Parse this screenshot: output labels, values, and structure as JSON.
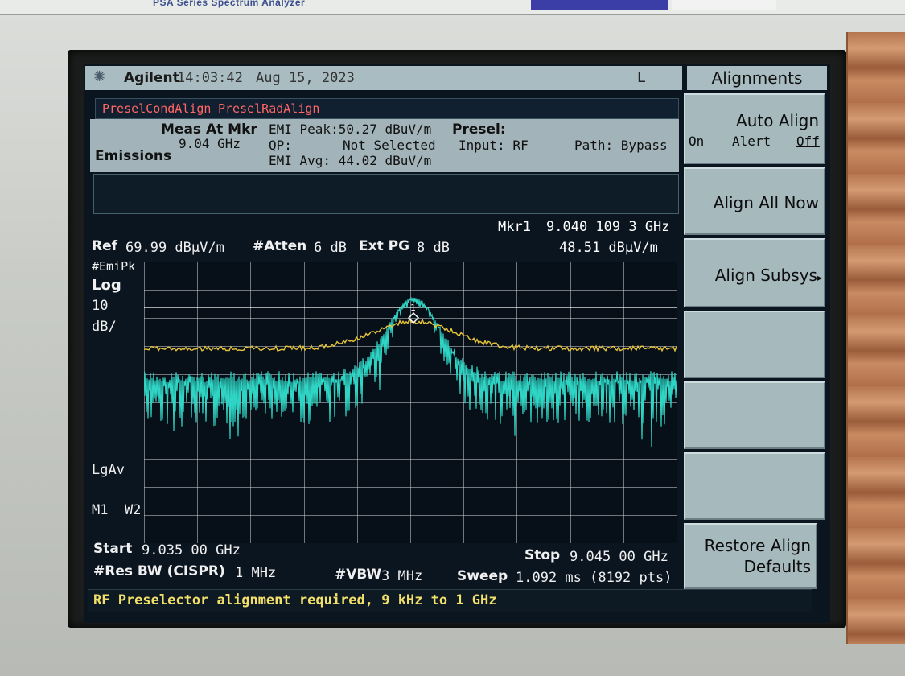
{
  "bezel": {
    "brand_text": "PSA Series Spectrum Analyzer"
  },
  "title_bar": {
    "logo_icon": "agilent-spark-icon",
    "brand": "Agilent",
    "time": "14:03:42",
    "date": "Aug 15, 2023",
    "mode": "L"
  },
  "alignment_banner": {
    "item1": "PreselCondAlign",
    "item2": "PreselRadAlign"
  },
  "measurement": {
    "label_meas_at_mkr": "Meas At Mkr",
    "freq": "9.04 GHz",
    "emissions": "Emissions",
    "emi_peak": "EMI Peak:50.27 dBuV/m",
    "qp_label": "QP:",
    "qp_value": "Not Selected",
    "emi_avg": "EMI Avg: 44.02 dBuV/m",
    "presel_label": "Presel:",
    "input": "Input: RF",
    "path": "Path: Bypass"
  },
  "marker": {
    "label": "Mkr1",
    "freq": "9.040 109 3 GHz",
    "level": "48.51 dBµV/m",
    "number": "1"
  },
  "ref": {
    "ref_label": "Ref",
    "ref_value": "69.99 dBµV/m",
    "atten_label": "#Atten",
    "atten_value": "6 dB",
    "extpg_label": "Ext PG",
    "extpg_value": "8 dB"
  },
  "left_annotations": {
    "detector": "#EmiPk",
    "scale_type": "Log",
    "scale_value": "10",
    "scale_unit": "dB/",
    "avg": "LgAv",
    "trace_mode": "M1  W2"
  },
  "bottom": {
    "start_label": "Start",
    "start_value": "9.035 00 GHz",
    "stop_label": "Stop",
    "stop_value": "9.045 00 GHz",
    "rbw_label": "#Res BW (CISPR)",
    "rbw_value": "1 MHz",
    "vbw_label": "#VBW",
    "vbw_value": "3 MHz",
    "sweep_label": "Sweep",
    "sweep_value": "1.092 ms (8192 pts)"
  },
  "softkeys": {
    "title": "Alignments",
    "auto_align": "Auto Align",
    "auto_align_options": [
      "On",
      "Alert",
      "Off"
    ],
    "auto_align_selected": "Off",
    "align_all_now": "Align All Now",
    "align_subsys": "Align Subsys",
    "restore_line1": "Restore Align",
    "restore_line2": "Defaults"
  },
  "status_message": "RF Preselector alignment required, 9 kHz to 1 GHz",
  "colors": {
    "trace1": "#e8c43a",
    "trace2": "#2fd4c4",
    "marker": "#ffffff",
    "grid": "#c8cccf"
  }
}
